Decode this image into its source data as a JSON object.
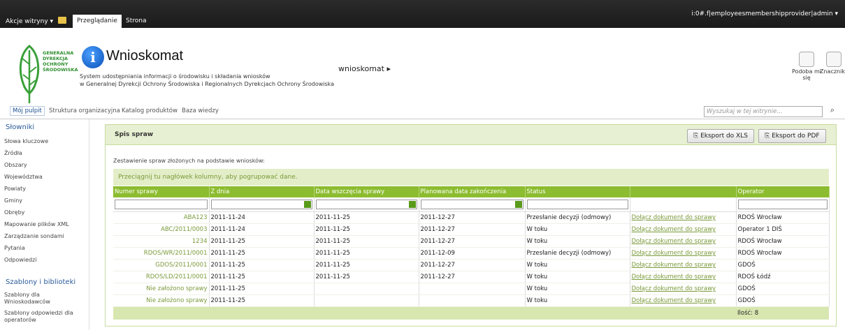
{
  "ribbon": {
    "site_actions": "Akcje witryny ▾",
    "tabs": [
      "Przeglądanie",
      "Strona"
    ],
    "user": "i:0#.f|employeesmembershipprovider|admin ▾"
  },
  "header": {
    "org_name": [
      "GENERALNA",
      "DYREKCJA",
      "OCHRONY",
      "ŚRODOWISKA"
    ],
    "title": "Wnioskomat",
    "description": [
      "System udostępniania informacji o środowisku i składania wniosków",
      "w Generalnej Dyrekcji Ochrony Środowiska i Regionalnych Dyrekcjach Ochrony Środowiska"
    ],
    "breadcrumb": "wnioskomat ▸",
    "actions": [
      {
        "label": "Podoba mi się",
        "icon": "like-tag-icon"
      },
      {
        "label": "Znaczniki i notatki",
        "icon": "tags-notes-icon"
      }
    ]
  },
  "topnav": {
    "items": [
      "Mój pulpit",
      "Struktura organizacyjna",
      "Katalog produktów",
      "Baza wiedzy"
    ],
    "search_placeholder": "Wyszukaj w tej witrynie..."
  },
  "leftnav": {
    "section1_title": "Słowniki",
    "section1_items": [
      "Słowa kluczowe",
      "Źródła",
      "Obszary",
      "Województwa",
      "Powiaty",
      "Gminy",
      "Obręby",
      "Mapowanie plików XML",
      "Zarządzanie sondami",
      "Pytania",
      "Odpowiedzi"
    ],
    "section2_title": "Szablony i biblioteki",
    "section2_items": [
      "Szablony dla Wnioskodawców",
      "Szablony odpowiedzi dla operatorów"
    ]
  },
  "main": {
    "panel_title": "Spis spraw",
    "export_xls": "Eksport do XLS",
    "export_pdf": "Eksport do PDF",
    "caption": "Zestawienie spraw złożonych na podstawie wniosków:",
    "group_hint": "Przeciągnij tu nagłówek kolumny, aby pogrupować dane.",
    "columns": [
      "Numer sprawy",
      "Z dnia",
      "Data wszczęcia sprawy",
      "Planowana data zakończenia",
      "Status",
      "",
      "Operator"
    ],
    "rows": [
      {
        "num": "ABA123",
        "z_dnia": "2011-11-24",
        "wszczecie": "2011-11-25",
        "plan": "2011-12-27",
        "status": "Przesłanie decyzji (odmowy)",
        "akcja": "Dołącz dokument do sprawy",
        "operator": "RDOŚ Wrocław"
      },
      {
        "num": "ABC/2011/0003",
        "z_dnia": "2011-11-24",
        "wszczecie": "2011-11-25",
        "plan": "2011-12-27",
        "status": "W toku",
        "akcja": "Dołącz dokument do sprawy",
        "operator": "Operator 1 DIŚ"
      },
      {
        "num": "1234",
        "z_dnia": "2011-11-25",
        "wszczecie": "2011-11-25",
        "plan": "2011-12-27",
        "status": "W toku",
        "akcja": "Dołącz dokument do sprawy",
        "operator": "RDOŚ Wrocław"
      },
      {
        "num": "RDOS/WR/2011/0001",
        "z_dnia": "2011-11-25",
        "wszczecie": "2011-11-25",
        "plan": "2011-12-09",
        "status": "Przesłanie decyzji (odmowy)",
        "akcja": "Dołącz dokument do sprawy",
        "operator": "RDOŚ Wrocław"
      },
      {
        "num": "GDOS/2011/0001",
        "z_dnia": "2011-11-25",
        "wszczecie": "2011-11-25",
        "plan": "2011-12-27",
        "status": "W toku",
        "akcja": "Dołącz dokument do sprawy",
        "operator": "GDOŚ"
      },
      {
        "num": "RDOS/LD/2011/0001",
        "z_dnia": "2011-11-25",
        "wszczecie": "2011-11-25",
        "plan": "2011-12-27",
        "status": "W toku",
        "akcja": "Dołącz dokument do sprawy",
        "operator": "RDOŚ Łódź"
      },
      {
        "num": "Nie założono sprawy",
        "z_dnia": "2011-11-25",
        "wszczecie": "",
        "plan": "",
        "status": "W toku",
        "akcja": "Dołącz dokument do sprawy",
        "operator": "GDOŚ"
      },
      {
        "num": "Nie założono sprawy",
        "z_dnia": "2011-11-25",
        "wszczecie": "",
        "plan": "",
        "status": "W toku",
        "akcja": "Dołącz dokument do sprawy",
        "operator": "GDOŚ"
      }
    ],
    "count_label": "Ilość: 8"
  }
}
